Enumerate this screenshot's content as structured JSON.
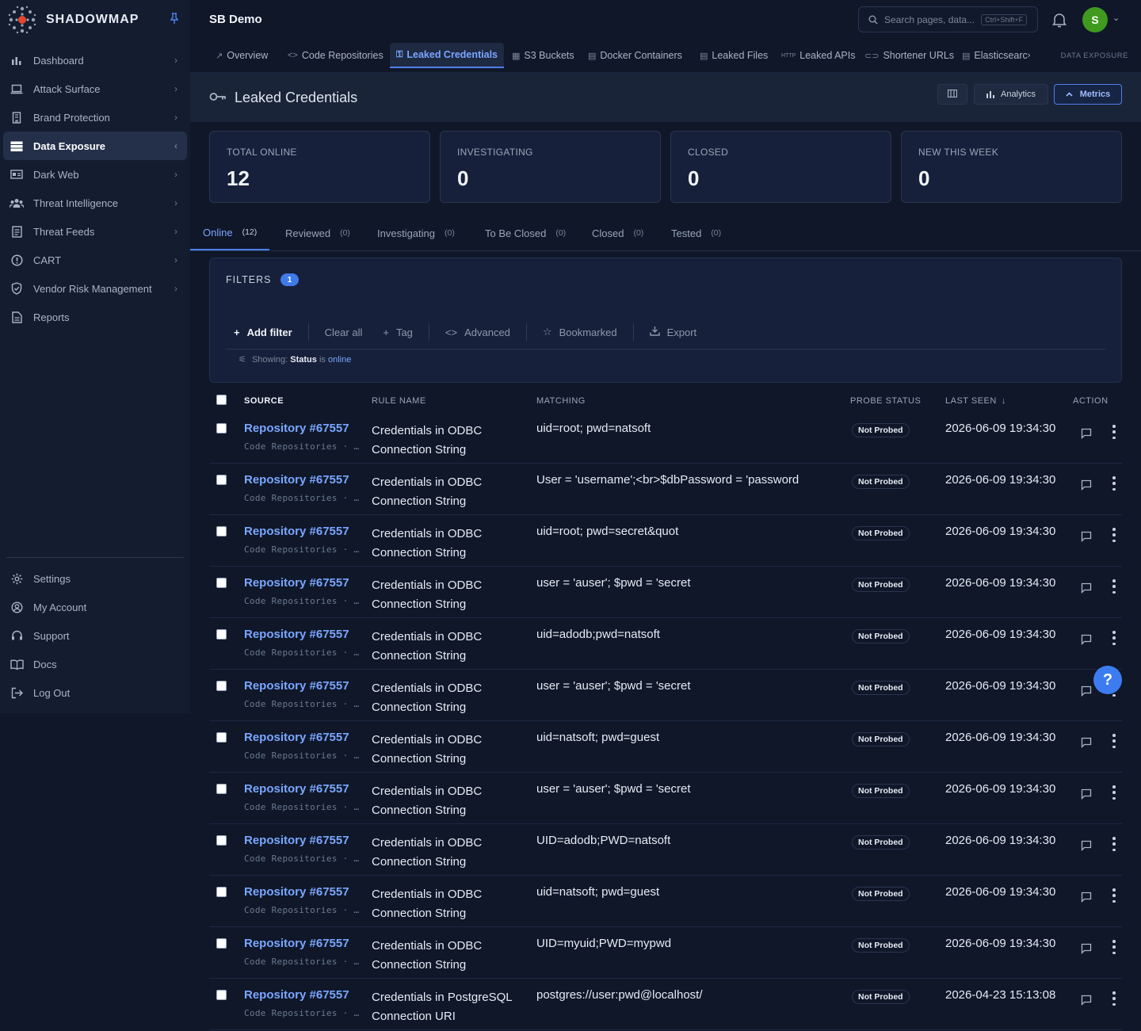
{
  "brand": {
    "name": "SHADOWMAP"
  },
  "sidebar": {
    "items": [
      {
        "label": "Dashboard",
        "icon": "bar-chart-icon"
      },
      {
        "label": "Attack Surface",
        "icon": "laptop-icon"
      },
      {
        "label": "Brand Protection",
        "icon": "building-icon"
      },
      {
        "label": "Data Exposure",
        "icon": "server-icon",
        "active": true
      },
      {
        "label": "Dark Web",
        "icon": "id-card-icon"
      },
      {
        "label": "Threat Intelligence",
        "icon": "users-icon"
      },
      {
        "label": "Threat Feeds",
        "icon": "document-icon"
      },
      {
        "label": "CART",
        "icon": "alert-circle-icon"
      },
      {
        "label": "Vendor Risk Management",
        "icon": "shield-check-icon"
      },
      {
        "label": "Reports",
        "icon": "report-icon"
      }
    ],
    "bottom_items": [
      {
        "label": "Settings",
        "icon": "gear-icon"
      },
      {
        "label": "My Account",
        "icon": "user-circle-icon"
      },
      {
        "label": "Support",
        "icon": "headset-icon"
      },
      {
        "label": "Docs",
        "icon": "book-icon"
      },
      {
        "label": "Log Out",
        "icon": "logout-icon"
      }
    ]
  },
  "header": {
    "workspace": "SB Demo",
    "search_placeholder": "Search pages, data...",
    "search_shortcut": "Ctrl+Shift+F",
    "avatar_initial": "S"
  },
  "subnav": {
    "tabs": [
      {
        "label": "Overview"
      },
      {
        "label": "Code Repositories"
      },
      {
        "label": "Leaked Credentials",
        "active": true
      },
      {
        "label": "S3 Buckets"
      },
      {
        "label": "Docker Containers"
      },
      {
        "label": "Leaked Files"
      },
      {
        "label": "Leaked APIs"
      },
      {
        "label": "Shortener URLs"
      },
      {
        "label": "Elasticsearc"
      }
    ],
    "section_label": "DATA EXPOSURE"
  },
  "page": {
    "title": "Leaked Credentials",
    "analytics_label": "Analytics",
    "metrics_label": "Metrics"
  },
  "stats": [
    {
      "label": "TOTAL ONLINE",
      "value": "12"
    },
    {
      "label": "INVESTIGATING",
      "value": "0"
    },
    {
      "label": "CLOSED",
      "value": "0"
    },
    {
      "label": "NEW THIS WEEK",
      "value": "0"
    }
  ],
  "status_tabs": [
    {
      "label": "Online",
      "count": "(12)",
      "active": true
    },
    {
      "label": "Reviewed",
      "count": "(0)"
    },
    {
      "label": "Investigating",
      "count": "(0)"
    },
    {
      "label": "To Be Closed",
      "count": "(0)"
    },
    {
      "label": "Closed",
      "count": "(0)"
    },
    {
      "label": "Tested",
      "count": "(0)"
    }
  ],
  "filters": {
    "title": "FILTERS",
    "count": "1",
    "add_filter": "Add filter",
    "clear_all": "Clear all",
    "tag": "Tag",
    "advanced": "Advanced",
    "bookmarked": "Bookmarked",
    "export": "Export",
    "showing_prefix": "Showing:",
    "showing_field": "Status",
    "showing_op": "is",
    "showing_value": "online"
  },
  "table": {
    "columns": {
      "source": "SOURCE",
      "rule": "RULE NAME",
      "matching": "MATCHING",
      "probe": "PROBE STATUS",
      "last_seen": "LAST SEEN",
      "action": "ACTION"
    },
    "rows": [
      {
        "repo": "Repository #67557",
        "sub": "Code Repositories · …",
        "rule": "Credentials in ODBC Connection String",
        "match": "uid=root; pwd=natsoft",
        "probe": "Not Probed",
        "seen": "2026-06-09 19:34:30"
      },
      {
        "repo": "Repository #67557",
        "sub": "Code Repositories · …",
        "rule": "Credentials in ODBC Connection String",
        "match": "User = 'username';<br>$dbPassword = 'password",
        "probe": "Not Probed",
        "seen": "2026-06-09 19:34:30"
      },
      {
        "repo": "Repository #67557",
        "sub": "Code Repositories · …",
        "rule": "Credentials in ODBC Connection String",
        "match": "uid=root; pwd=secret&quot",
        "probe": "Not Probed",
        "seen": "2026-06-09 19:34:30"
      },
      {
        "repo": "Repository #67557",
        "sub": "Code Repositories · …",
        "rule": "Credentials in ODBC Connection String",
        "match": "user = 'auser'; $pwd = 'secret",
        "probe": "Not Probed",
        "seen": "2026-06-09 19:34:30"
      },
      {
        "repo": "Repository #67557",
        "sub": "Code Repositories · …",
        "rule": "Credentials in ODBC Connection String",
        "match": "uid=adodb;pwd=natsoft",
        "probe": "Not Probed",
        "seen": "2026-06-09 19:34:30"
      },
      {
        "repo": "Repository #67557",
        "sub": "Code Repositories · …",
        "rule": "Credentials in ODBC Connection String",
        "match": "user = 'auser'; $pwd = 'secret",
        "probe": "Not Probed",
        "seen": "2026-06-09 19:34:30"
      },
      {
        "repo": "Repository #67557",
        "sub": "Code Repositories · …",
        "rule": "Credentials in ODBC Connection String",
        "match": "uid=natsoft; pwd=guest",
        "probe": "Not Probed",
        "seen": "2026-06-09 19:34:30"
      },
      {
        "repo": "Repository #67557",
        "sub": "Code Repositories · …",
        "rule": "Credentials in ODBC Connection String",
        "match": "user = 'auser'; $pwd = 'secret",
        "probe": "Not Probed",
        "seen": "2026-06-09 19:34:30"
      },
      {
        "repo": "Repository #67557",
        "sub": "Code Repositories · …",
        "rule": "Credentials in ODBC Connection String",
        "match": "UID=adodb;PWD=natsoft",
        "probe": "Not Probed",
        "seen": "2026-06-09 19:34:30"
      },
      {
        "repo": "Repository #67557",
        "sub": "Code Repositories · …",
        "rule": "Credentials in ODBC Connection String",
        "match": "uid=natsoft; pwd=guest",
        "probe": "Not Probed",
        "seen": "2026-06-09 19:34:30"
      },
      {
        "repo": "Repository #67557",
        "sub": "Code Repositories · …",
        "rule": "Credentials in ODBC Connection String",
        "match": "UID=myuid;PWD=mypwd",
        "probe": "Not Probed",
        "seen": "2026-06-09 19:34:30"
      },
      {
        "repo": "Repository #67557",
        "sub": "Code Repositories · …",
        "rule": "Credentials in PostgreSQL Connection URI",
        "match": "postgres://user:pwd@localhost/",
        "probe": "Not Probed",
        "seen": "2026-04-23 15:13:08"
      }
    ]
  },
  "help": {
    "label": "?"
  }
}
